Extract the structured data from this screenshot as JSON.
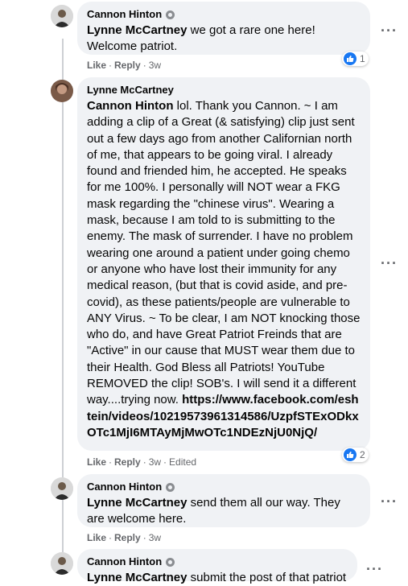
{
  "comments": [
    {
      "author": "Cannon Hinton",
      "mention": "Lynne McCartney",
      "text": " we got a rare one here! Welcome patriot.",
      "like": "Like",
      "reply": "Reply",
      "time": "3w",
      "reactions": "1"
    },
    {
      "author": "Lynne McCartney",
      "mention": "Cannon Hinton",
      "text": " lol. Thank you Cannon. ~ I am adding a clip of a Great (& satisfying) clip just sent out a few days ago from another Californian north of me, that appears to be going viral. I already found and friended him, he accepted. He speaks for me 100%. I personally will NOT wear a FKG mask regarding the \"chinese virus\". Wearing a mask, because I am told to is submitting to the enemy. The mask of surrender. I have no problem wearing one around a patient under going chemo or anyone who have lost their immunity for any medical reason, (but that is covid aside, and pre-covid), as these patients/people are vulnerable to ANY Virus. ~ To be clear, I am NOT knocking those who do, and have Great Patriot Freinds that are \"Active\" in our cause that MUST wear them due to their Health. God Bless all Patriots! YouTube REMOVED the clip! SOB's. I will send it a different way....trying now. ",
      "link": "https://www.facebook.com/eshtein/videos/10219573961314586/UzpfSTExODkxOTc1MjI6MTAyMjMwOTc1NDEzNjU0NjQ/",
      "like": "Like",
      "reply": "Reply",
      "time": "3w",
      "edited": "Edited",
      "reactions": "2"
    },
    {
      "author": "Cannon Hinton",
      "mention": "Lynne McCartney",
      "text": " send them all our way. They are welcome here.",
      "like": "Like",
      "reply": "Reply",
      "time": "3w"
    },
    {
      "author": "Cannon Hinton",
      "mention": "Lynne McCartney",
      "text": " submit the post of that patriot"
    }
  ],
  "colors": {
    "bubble": "#f0f2f5",
    "meta": "#65676b",
    "like": "#1877f2"
  }
}
